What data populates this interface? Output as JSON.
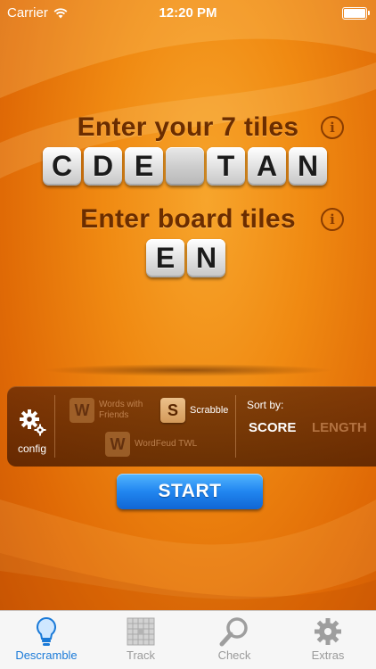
{
  "status_bar": {
    "carrier": "Carrier",
    "time": "12:20 PM"
  },
  "rack": {
    "title": "Enter your 7 tiles",
    "info_icon": "info-icon",
    "tiles": [
      "C",
      "D",
      "E",
      "",
      "T",
      "A",
      "N"
    ]
  },
  "board": {
    "title": "Enter board tiles",
    "info_icon": "info-icon",
    "tiles": [
      "E",
      "N"
    ]
  },
  "panel": {
    "config_label": "config",
    "games": {
      "wwf": {
        "letter": "W",
        "name": "Words with Friends",
        "selected": false
      },
      "scrabble": {
        "letter": "S",
        "name": "Scrabble",
        "selected": true
      },
      "wordfeud": {
        "letter": "W",
        "name": "WordFeud TWL",
        "selected": false
      }
    },
    "sort_label": "Sort by:",
    "sort_options": {
      "score": "SCORE",
      "length": "LENGTH"
    },
    "sort_selected": "SCORE"
  },
  "start_label": "START",
  "tabs": [
    {
      "label": "Descramble",
      "icon": "lightbulb-icon",
      "active": true
    },
    {
      "label": "Track",
      "icon": "grid-board-icon",
      "active": false
    },
    {
      "label": "Check",
      "icon": "magnifier-icon",
      "active": false
    },
    {
      "label": "Extras",
      "icon": "gear-icon",
      "active": false
    }
  ],
  "colors": {
    "accent": "#1a7ad8",
    "background": "#f08a12",
    "heading": "#6b2d00",
    "start_button": "#2186f0"
  }
}
